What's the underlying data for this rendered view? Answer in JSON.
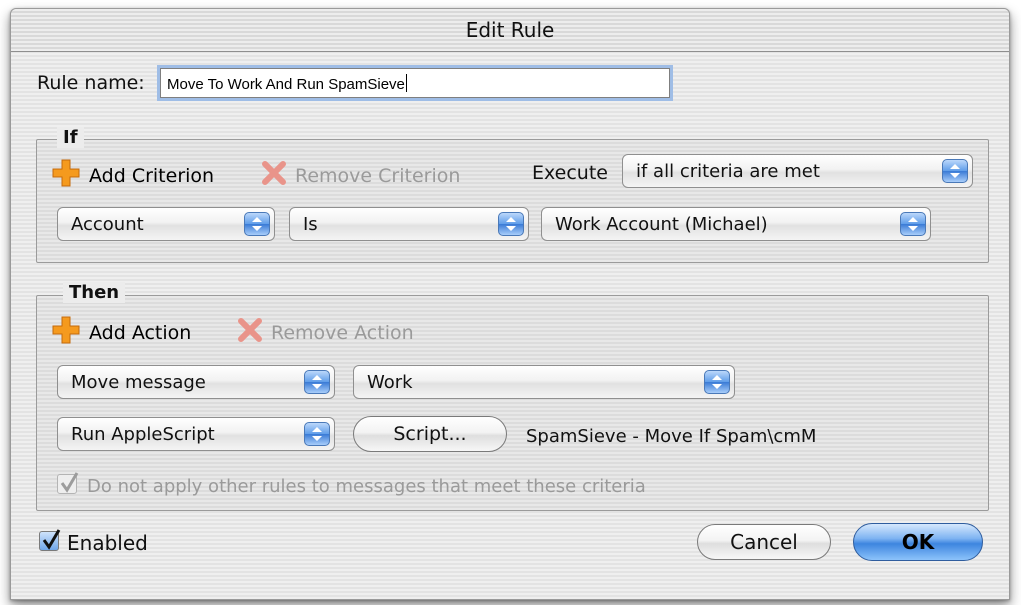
{
  "window": {
    "title": "Edit Rule"
  },
  "rule_name": {
    "label": "Rule name:",
    "value": "Move To Work And Run SpamSieve"
  },
  "if_section": {
    "title": "If",
    "add_criterion": "Add Criterion",
    "remove_criterion": "Remove Criterion",
    "execute_label": "Execute",
    "execute_value": "if all criteria are met",
    "criterion": {
      "field": "Account",
      "operator": "Is",
      "value": "Work Account (Michael)"
    }
  },
  "then_section": {
    "title": "Then",
    "add_action": "Add Action",
    "remove_action": "Remove Action",
    "action1": {
      "type": "Move message",
      "target": "Work"
    },
    "action2": {
      "type": "Run AppleScript",
      "script_button": "Script...",
      "script_name": "SpamSieve - Move If Spam\\cmM"
    },
    "stop_rules": {
      "label": "Do not apply other rules to messages that meet these criteria",
      "checked": true,
      "enabled": false
    }
  },
  "enabled": {
    "label": "Enabled",
    "checked": true
  },
  "buttons": {
    "cancel": "Cancel",
    "ok": "OK"
  },
  "colors": {
    "accent": "#3d85df",
    "add_icon": "#f59a1e",
    "remove_icon": "#e25b4c"
  },
  "icons": {
    "add": "plus-icon",
    "remove": "x-icon",
    "popup": "updown-arrows-icon",
    "check": "checkmark-icon"
  }
}
